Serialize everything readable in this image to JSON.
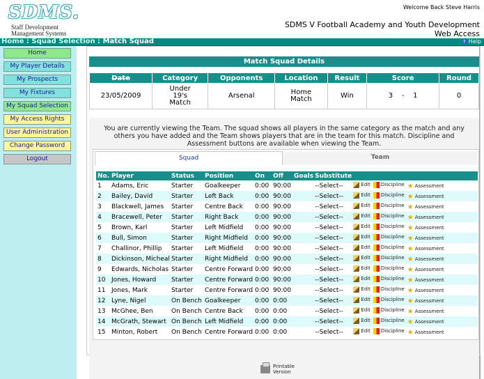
{
  "header": {
    "logo_main": "SDMS.",
    "logo_sub1": "Staff Development",
    "logo_sub2": "Management Systems",
    "welcome": "Welcome Back Steve Harris",
    "org_line1": "SDMS V Football Academy and Youth Development",
    "org_line2": "Web Access"
  },
  "breadcrumb": {
    "home": "Home",
    "sep": " : ",
    "section": "Squad Selection",
    "current": "Match Squad",
    "help": "Help"
  },
  "sidebar": {
    "items": [
      {
        "label": "Home",
        "color": "#8fe68f"
      },
      {
        "label": "My Player Details",
        "color": "#82e0dd"
      },
      {
        "label": "My Prospects",
        "color": "#82e0dd"
      },
      {
        "label": "My Fixtures",
        "color": "#82e0dd"
      },
      {
        "label": "My Squad Selection",
        "color": "#8fe68f"
      },
      {
        "label": "My Access Rights",
        "color": "#fff59d"
      },
      {
        "label": "User Administration",
        "color": "#fff59d"
      },
      {
        "label": "Change Password",
        "color": "#fff59d"
      },
      {
        "label": "Logout",
        "color": "#c6c6c6"
      }
    ]
  },
  "match": {
    "title": "Match Squad Details",
    "headers": [
      "Date",
      "Category",
      "Opponents",
      "Location",
      "Result",
      "Score",
      "Round"
    ],
    "date": "23/05/2009",
    "category_1": "Under",
    "category_2": "19's",
    "category_3": "Match",
    "opponents": "Arsenal",
    "location_1": "Home",
    "location_2": "Match",
    "result": "Win",
    "score": "3    -    1",
    "round": "0"
  },
  "info": {
    "text": "You are currently viewing the Team. The squad shows all players in the same category as the match and any others you have added and the Team shows players that are in the team for this match. Discipline and Assessment buttons are available when viewing the Team."
  },
  "tabs": {
    "squad": "Squad",
    "team": "Team"
  },
  "players": {
    "headers": [
      "No.",
      "Player",
      "Status",
      "Position",
      "On",
      "Off",
      "Goals",
      "Substitute"
    ],
    "actions": {
      "edit": "Edit",
      "discipline": "Discipline",
      "assessment": "Assessment"
    },
    "rows": [
      {
        "no": "1",
        "name": "Adams, Eric",
        "status": "Starter",
        "position": "Goalkeeper",
        "on": "0:00",
        "off": "90:00",
        "goals": "",
        "sub": "--Select--"
      },
      {
        "no": "2",
        "name": "Bailey, David",
        "status": "Starter",
        "position": "Left Back",
        "on": "0:00",
        "off": "90:00",
        "goals": "",
        "sub": "--Select--"
      },
      {
        "no": "3",
        "name": "Blackwell, James",
        "status": "Starter",
        "position": "Centre Back",
        "on": "0:00",
        "off": "90:00",
        "goals": "",
        "sub": "--Select--"
      },
      {
        "no": "4",
        "name": "Bracewell, Peter",
        "status": "Starter",
        "position": "Right Back",
        "on": "0:00",
        "off": "90:00",
        "goals": "",
        "sub": "--Select--"
      },
      {
        "no": "5",
        "name": "Brown, Karl",
        "status": "Starter",
        "position": "Left Midfield",
        "on": "0:00",
        "off": "90:00",
        "goals": "",
        "sub": "--Select--"
      },
      {
        "no": "6",
        "name": "Bull, Simon",
        "status": "Starter",
        "position": "Right Midfield",
        "on": "0:00",
        "off": "90:00",
        "goals": "",
        "sub": "--Select--"
      },
      {
        "no": "7",
        "name": "Challinor, Phillip",
        "status": "Starter",
        "position": "Left Midfield",
        "on": "0:00",
        "off": "90:00",
        "goals": "",
        "sub": "--Select--"
      },
      {
        "no": "8",
        "name": "Dickinson, Micheal",
        "status": "Starter",
        "position": "Right Midfield",
        "on": "0:00",
        "off": "90:00",
        "goals": "",
        "sub": "--Select--"
      },
      {
        "no": "9",
        "name": "Edwards, Nicholas",
        "status": "Starter",
        "position": "Centre Forward",
        "on": "0:00",
        "off": "90:00",
        "goals": "",
        "sub": "--Select--"
      },
      {
        "no": "10",
        "name": "Jones, Howard",
        "status": "Starter",
        "position": "Centre Forward",
        "on": "0:00",
        "off": "90:00",
        "goals": "",
        "sub": "--Select--"
      },
      {
        "no": "11",
        "name": "Jones, Mark",
        "status": "Starter",
        "position": "Centre Forward",
        "on": "0:00",
        "off": "90:00",
        "goals": "",
        "sub": "--Select--"
      },
      {
        "no": "12",
        "name": "Lyne, Nigel",
        "status": "On Bench",
        "position": "Goalkeeper",
        "on": "0:00",
        "off": "0:00",
        "goals": "",
        "sub": "--Select--"
      },
      {
        "no": "13",
        "name": "McGhee, Ben",
        "status": "On Bench",
        "position": "Centre Back",
        "on": "0:00",
        "off": "0:00",
        "goals": "",
        "sub": "--Select--"
      },
      {
        "no": "14",
        "name": "McGrath, Stewart",
        "status": "On Bench",
        "position": "Left Midfield",
        "on": "0:00",
        "off": "0:00",
        "goals": "",
        "sub": "--Select--"
      },
      {
        "no": "15",
        "name": "Minton, Robert",
        "status": "On Bench",
        "position": "Centre Forward",
        "on": "0:00",
        "off": "0:00",
        "goals": "",
        "sub": "--Select--"
      }
    ]
  },
  "footer": {
    "printable_1": "Printable",
    "printable_2": "Version"
  }
}
